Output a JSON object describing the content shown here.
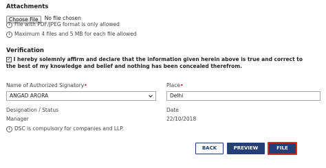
{
  "attachments": {
    "heading": "Attachments",
    "choose_button": "Choose File",
    "file_status": "No file chosen",
    "info_format": "File with PDF/JPEG format is only allowed",
    "info_limit": "Maximum 4 files and 5 MB for each file allowed"
  },
  "verification": {
    "heading": "Verification",
    "checked": true,
    "declaration": "I hereby solemnly affirm and declare that the information given herein above is true and correct to the best of my knowledge and belief and nothing has been concealed therefrom."
  },
  "form": {
    "signatory_label": "Name of Authorized Signatory",
    "signatory_value": "ANGAD ARORA",
    "place_label": "Place",
    "place_value": "Delhi",
    "designation_label": "Designation / Status",
    "designation_value": "Manager",
    "date_label": "Date",
    "date_value": "22/10/2018",
    "required_mark": "•"
  },
  "dsc_note": "DSC is compulsory for companies and LLP.",
  "buttons": {
    "back": "BACK",
    "preview": "PREVIEW",
    "file": "FILE"
  },
  "colors": {
    "primary": "#243f76",
    "highlight_border": "#d12b3a",
    "required": "#d0021b"
  }
}
